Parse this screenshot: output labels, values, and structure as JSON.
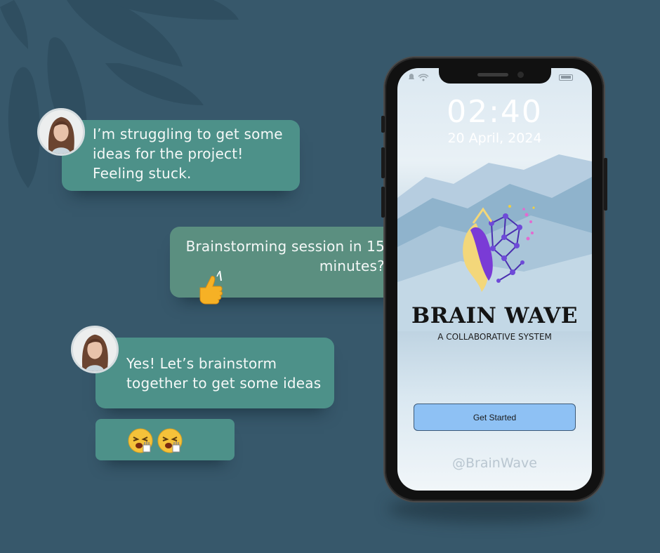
{
  "chat": {
    "messages": [
      {
        "text": "I’m struggling to get some ideas for the project! Feeling stuck."
      },
      {
        "text": "Brainstorming session in 15 minutes?"
      },
      {
        "text": "Yes! Let’s brainstorm together to get some ideas"
      }
    ]
  },
  "phone": {
    "lockscreen": {
      "time": "02:40",
      "date": "20 April, 2024"
    },
    "app": {
      "name": "BRAIN WAVE",
      "tagline": "A COLLABORATIVE SYSTEM",
      "cta_label": "Get Started",
      "handle": "@BrainWave"
    }
  },
  "colors": {
    "background": "#37586b",
    "bubble": "#4d9189",
    "bubble_alt": "#5b8f80",
    "cta": "#8ec1f4"
  },
  "icons": [
    "thumbs-up-icon",
    "laughing-emoji-icon",
    "bell-icon",
    "wifi-icon",
    "battery-icon",
    "brain-logo-icon"
  ]
}
